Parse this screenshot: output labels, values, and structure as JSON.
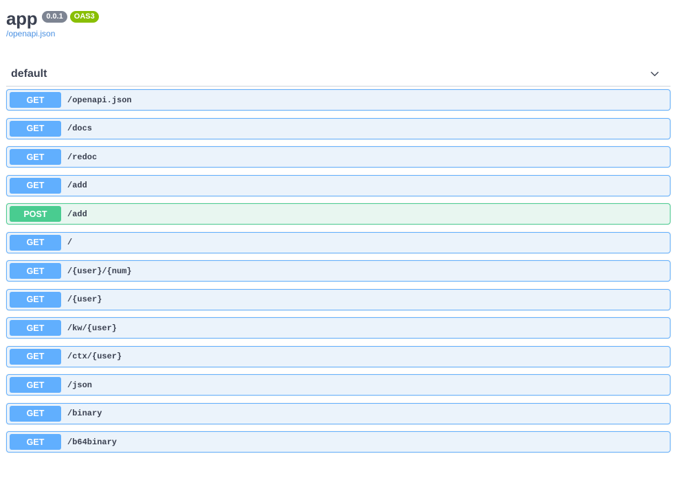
{
  "info": {
    "title": "app",
    "version": "0.0.1",
    "oas": "OAS3",
    "spec_link": "/openapi.json"
  },
  "tag": {
    "name": "default",
    "expand_icon": "chevron-down-icon"
  },
  "colors": {
    "get": "#61affe",
    "get_bg": "#ebf3fb",
    "post": "#49cc90",
    "post_bg": "#e8f6f0"
  },
  "operations": [
    {
      "method": "GET",
      "path": "/openapi.json"
    },
    {
      "method": "GET",
      "path": "/docs"
    },
    {
      "method": "GET",
      "path": "/redoc"
    },
    {
      "method": "GET",
      "path": "/add"
    },
    {
      "method": "POST",
      "path": "/add"
    },
    {
      "method": "GET",
      "path": "/"
    },
    {
      "method": "GET",
      "path": "/{user}/{num}"
    },
    {
      "method": "GET",
      "path": "/{user}"
    },
    {
      "method": "GET",
      "path": "/kw/{user}"
    },
    {
      "method": "GET",
      "path": "/ctx/{user}"
    },
    {
      "method": "GET",
      "path": "/json"
    },
    {
      "method": "GET",
      "path": "/binary"
    },
    {
      "method": "GET",
      "path": "/b64binary"
    }
  ]
}
